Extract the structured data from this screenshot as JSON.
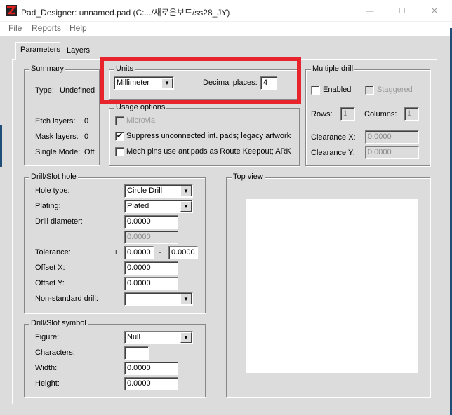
{
  "window": {
    "title": "Pad_Designer: unnamed.pad (C:.../새로운보드/ss28_JY)",
    "minimize_glyph": "—",
    "maximize_glyph": "☐",
    "close_glyph": "✕"
  },
  "menu": {
    "file": "File",
    "reports": "Reports",
    "help": "Help"
  },
  "tabs": {
    "parameters": "Parameters",
    "layers": "Layers"
  },
  "summary": {
    "title": "Summary",
    "type_label": "Type:",
    "type_value": "Undefined",
    "etch_label": "Etch layers:",
    "etch_value": "0",
    "mask_label": "Mask layers:",
    "mask_value": "0",
    "single_label": "Single Mode:",
    "single_value": "Off"
  },
  "units": {
    "title": "Units",
    "unit_value": "Millimeter",
    "decimal_label": "Decimal places:",
    "decimal_value": "4"
  },
  "usage": {
    "title": "Usage options",
    "microvia": "Microvia",
    "suppress": "Suppress unconnected int. pads; legacy artwork",
    "mech": "Mech pins use antipads as Route Keepout; ARK",
    "check_mark": "✔"
  },
  "multi_drill": {
    "title": "Multiple drill",
    "enabled": "Enabled",
    "staggered": "Staggered",
    "rows_label": "Rows:",
    "rows_value": "1",
    "cols_label": "Columns:",
    "cols_value": "1",
    "clearx_label": "Clearance X:",
    "clearx_value": "0.0000",
    "cleary_label": "Clearance Y:",
    "cleary_value": "0.0000"
  },
  "drill_hole": {
    "title": "Drill/Slot hole",
    "hole_type_label": "Hole type:",
    "hole_type_value": "Circle Drill",
    "plating_label": "Plating:",
    "plating_value": "Plated",
    "diameter_label": "Drill diameter:",
    "diameter_value": "0.0000",
    "diameter_value2": "0.0000",
    "tolerance_label": "Tolerance:",
    "plus": "+",
    "minus": "-",
    "tol_plus_value": "0.0000",
    "tol_minus_value": "0.0000",
    "offx_label": "Offset X:",
    "offx_value": "0.0000",
    "offy_label": "Offset Y:",
    "offy_value": "0.0000",
    "nonstd_label": "Non-standard drill:",
    "nonstd_value": ""
  },
  "drill_symbol": {
    "title": "Drill/Slot symbol",
    "figure_label": "Figure:",
    "figure_value": "Null",
    "chars_label": "Characters:",
    "chars_value": "",
    "width_label": "Width:",
    "width_value": "0.0000",
    "height_label": "Height:",
    "height_value": "0.0000"
  },
  "top_view": {
    "title": "Top view"
  },
  "colors": {
    "highlight": "#e8232b",
    "dialog_bg": "#dcdcdc"
  }
}
